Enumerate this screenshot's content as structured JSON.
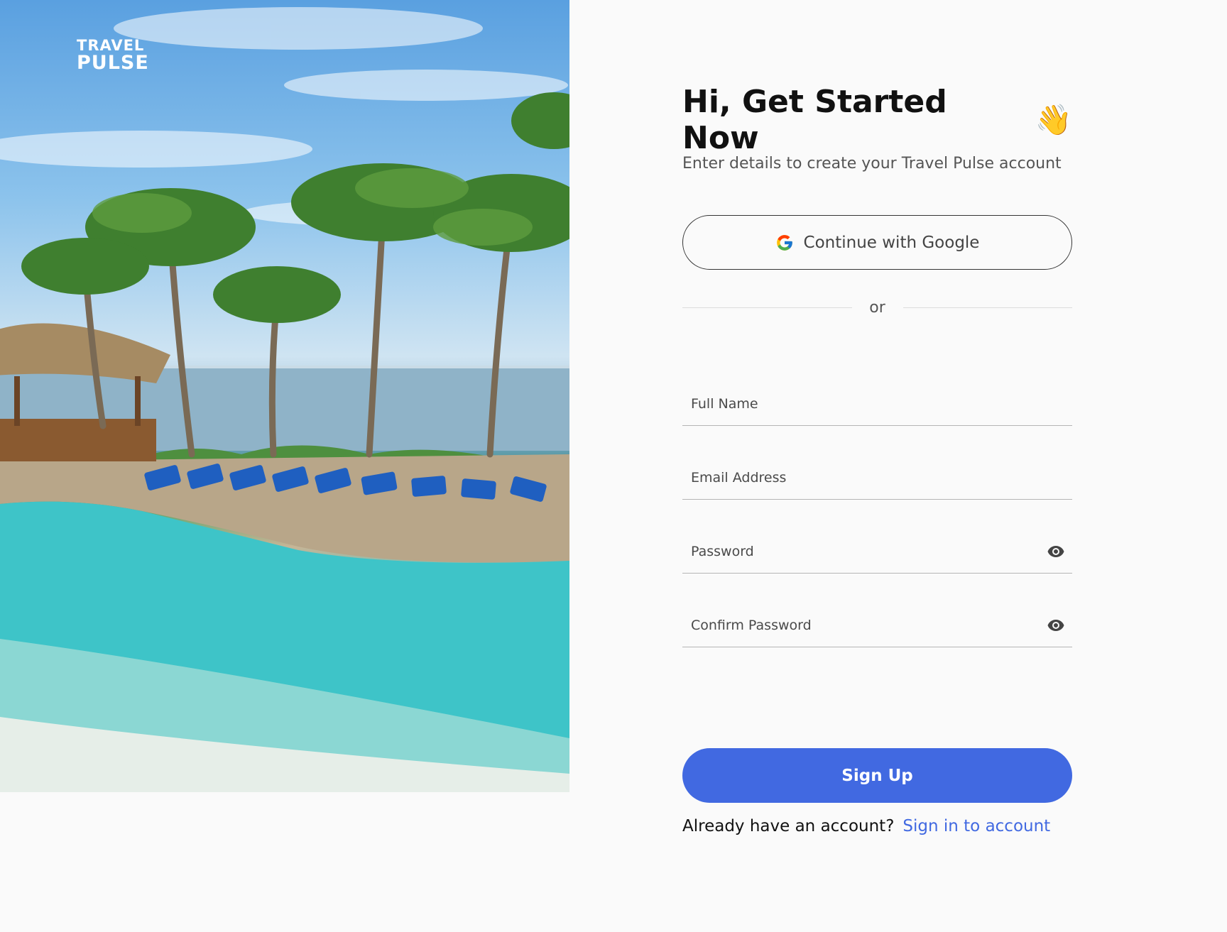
{
  "brand": {
    "logo_line1": "TRAVEL",
    "logo_line2": "PULSE"
  },
  "header": {
    "title": "Hi, Get Started Now",
    "wave_emoji": "👋",
    "subtitle": "Enter details to create your Travel Pulse account"
  },
  "google_button": {
    "label": "Continue with Google",
    "icon": "google-icon"
  },
  "divider": {
    "label": "or"
  },
  "fields": {
    "full_name": {
      "placeholder": "Full Name",
      "value": ""
    },
    "email": {
      "placeholder": "Email Address",
      "value": ""
    },
    "password": {
      "placeholder": "Password",
      "value": "",
      "icon": "eye-icon"
    },
    "confirm_password": {
      "placeholder": "Confirm Password",
      "value": "",
      "icon": "eye-icon"
    }
  },
  "submit": {
    "label": "Sign Up"
  },
  "footer": {
    "prompt": "Already have an account?",
    "link": "Sign in to account"
  },
  "colors": {
    "accent": "#4169e1",
    "background": "#fafafa",
    "text": "#111111"
  }
}
